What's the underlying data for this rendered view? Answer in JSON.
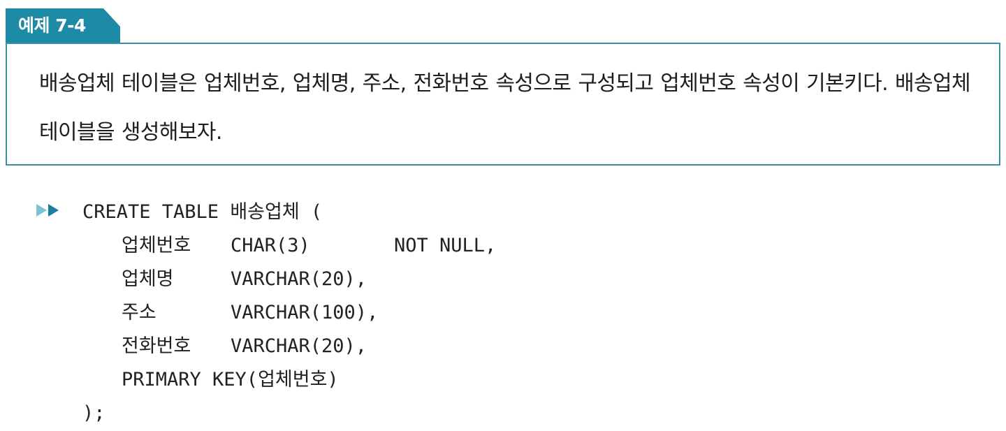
{
  "example": {
    "tab_label": "예제 7-4",
    "text": "배송업체 테이블은 업체번호, 업체명, 주소, 전화번호 속성으로 구성되고 업체번호 속성이 기본키다. 배송업체 테이블을 생성해보자."
  },
  "code": {
    "line1": "CREATE TABLE 배송업체 (",
    "rows": [
      {
        "name": "업체번호",
        "type": "CHAR(3)",
        "constraint": "NOT NULL,"
      },
      {
        "name": "업체명",
        "type": "VARCHAR(20),",
        "constraint": ""
      },
      {
        "name": "주소",
        "type": "VARCHAR(100),",
        "constraint": ""
      },
      {
        "name": "전화번호",
        "type": "VARCHAR(20),",
        "constraint": ""
      }
    ],
    "primary_key": "PRIMARY KEY(업체번호)",
    "closing": ");"
  },
  "colors": {
    "accent": "#1d8aa6",
    "border": "#3b8fa6",
    "marker_light": "#7cc2d4",
    "marker_dark": "#1b7f9e"
  }
}
